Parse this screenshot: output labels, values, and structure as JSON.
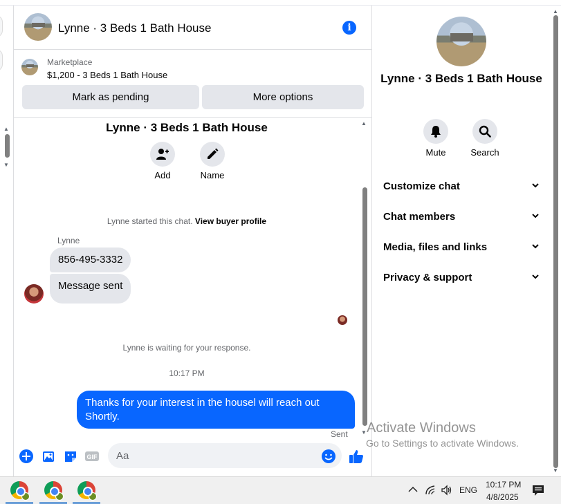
{
  "header": {
    "title": "Lynne · 3 Beds 1 Bath House"
  },
  "listing": {
    "source": "Marketplace",
    "price_title": "$1,200 - 3 Beds 1 Bath House",
    "mark_pending_label": "Mark as pending",
    "more_options_label": "More options"
  },
  "conversation": {
    "title": "Lynne · 3 Beds 1 Bath House",
    "add_label": "Add",
    "name_label": "Name",
    "started_text": "Lynne started this chat.",
    "view_profile_link": "View buyer profile",
    "sender_name": "Lynne",
    "incoming": [
      "856-495-3332",
      "Message sent"
    ],
    "waiting_text": "Lynne is waiting for your response.",
    "timestamp": "10:17 PM",
    "outgoing": "Thanks for your interest in the housel will reach out Shortly.",
    "sent_status": "Sent"
  },
  "composer": {
    "placeholder": "Aa",
    "icons": [
      "plus-icon",
      "photo-icon",
      "sticker-icon",
      "gif-icon",
      "emoji-icon",
      "thumbs-up-icon"
    ]
  },
  "sidebar": {
    "title": "Lynne · 3 Beds 1 Bath House",
    "mute_label": "Mute",
    "search_label": "Search",
    "sections": [
      "Customize chat",
      "Chat members",
      "Media, files and links",
      "Privacy & support"
    ]
  },
  "watermark": {
    "line1": "Activate Windows",
    "line2": "Go to Settings to activate Windows."
  },
  "taskbar": {
    "language": "ENG",
    "time": "10:17 PM",
    "date": "4/8/2025"
  },
  "colors": {
    "accent": "#0866ff",
    "bubble_in": "#e4e6eb",
    "text_secondary": "#65676b"
  }
}
